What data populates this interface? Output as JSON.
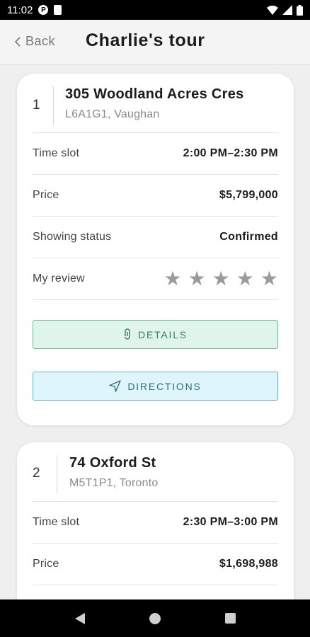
{
  "status_bar": {
    "time": "11:02",
    "app_icon_letter": "P"
  },
  "header": {
    "back_label": "Back",
    "title": "Charlie's tour"
  },
  "stops": [
    {
      "number": "1",
      "address": "305 Woodland Acres Cres",
      "sub_address": "L6A1G1, Vaughan",
      "time_slot_label": "Time slot",
      "time_slot": "2:00 PM–2:30 PM",
      "price_label": "Price",
      "price": "$5,799,000",
      "status_label": "Showing status",
      "status": "Confirmed",
      "review_label": "My review",
      "rating": 0,
      "max_rating": 5,
      "details_label": "DETAILS",
      "directions_label": "DIRECTIONS"
    },
    {
      "number": "2",
      "address": "74 Oxford St",
      "sub_address": "M5T1P1, Toronto",
      "time_slot_label": "Time slot",
      "time_slot": "2:30 PM–3:00 PM",
      "price_label": "Price",
      "price": "$1,698,988"
    }
  ],
  "colors": {
    "details_bg": "#dff5ea",
    "directions_bg": "#def5fb",
    "star_empty": "#9b9b9b"
  }
}
